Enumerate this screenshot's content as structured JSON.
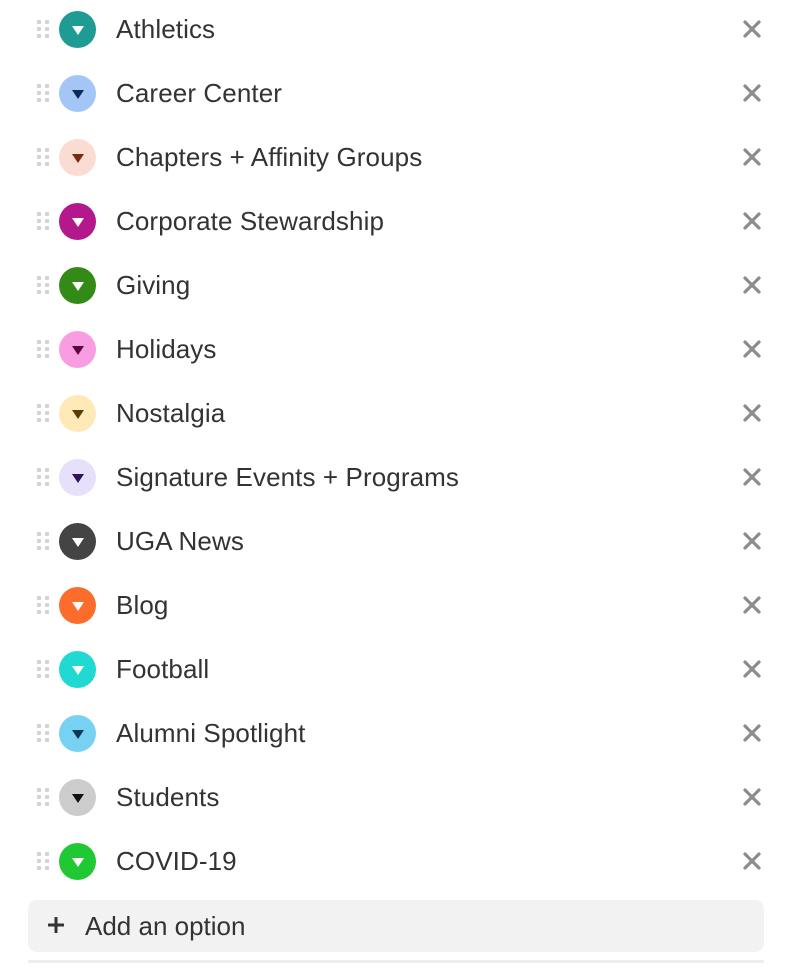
{
  "options": [
    {
      "label": "Athletics",
      "color": "#1e9c94",
      "caret_color": "#ffffff"
    },
    {
      "label": "Career Center",
      "color": "#a3c6f7",
      "caret_color": "#0c2a55"
    },
    {
      "label": "Chapters + Affinity Groups",
      "color": "#fbdcd2",
      "caret_color": "#7a2a14"
    },
    {
      "label": "Corporate Stewardship",
      "color": "#b4198b",
      "caret_color": "#ffffff"
    },
    {
      "label": "Giving",
      "color": "#338a17",
      "caret_color": "#ffffff"
    },
    {
      "label": "Holidays",
      "color": "#f99de2",
      "caret_color": "#5a0842"
    },
    {
      "label": "Nostalgia",
      "color": "#ffe9b6",
      "caret_color": "#5e3a05"
    },
    {
      "label": "Signature Events + Programs",
      "color": "#e7e0fb",
      "caret_color": "#2b1557"
    },
    {
      "label": "UGA News",
      "color": "#444444",
      "caret_color": "#ffffff"
    },
    {
      "label": "Blog",
      "color": "#fc6d2c",
      "caret_color": "#ffffff"
    },
    {
      "label": "Football",
      "color": "#20d9d2",
      "caret_color": "#ffffff"
    },
    {
      "label": "Alumni Spotlight",
      "color": "#77d1f3",
      "caret_color": "#0a3a52"
    },
    {
      "label": "Students",
      "color": "#cccccc",
      "caret_color": "#111111"
    },
    {
      "label": "COVID-19",
      "color": "#20c933",
      "caret_color": "#ffffff"
    }
  ],
  "icons": {
    "drag": "drag-handle-icon",
    "dot": "color-swatch-dropdown-icon",
    "remove": "close-icon",
    "add": "plus-icon"
  },
  "add_option": {
    "label": "Add an option"
  },
  "colors": {
    "text": "#333333",
    "remove_x": "#8c8c8c",
    "drag_dots": "#d3d3d3",
    "add_button_bg": "#f2f2f2"
  }
}
